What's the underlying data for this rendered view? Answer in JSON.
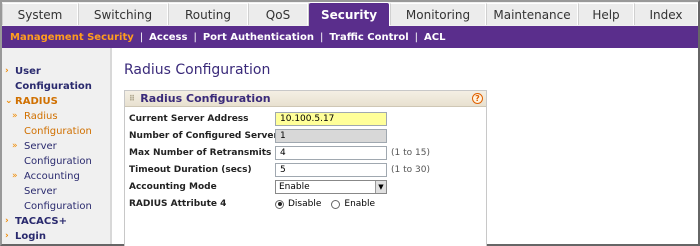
{
  "topnav": {
    "tabs": [
      {
        "label": "System",
        "active": false
      },
      {
        "label": "Switching",
        "active": false
      },
      {
        "label": "Routing",
        "active": false
      },
      {
        "label": "QoS",
        "active": false
      },
      {
        "label": "Security",
        "active": true
      },
      {
        "label": "Monitoring",
        "active": false
      },
      {
        "label": "Maintenance",
        "active": false
      },
      {
        "label": "Help",
        "active": false
      },
      {
        "label": "Index",
        "active": false
      }
    ]
  },
  "subnav": {
    "items": [
      {
        "label": "Management Security",
        "active": true
      },
      {
        "label": "Access",
        "active": false
      },
      {
        "label": "Port Authentication",
        "active": false
      },
      {
        "label": "Traffic Control",
        "active": false
      },
      {
        "label": "ACL",
        "active": false
      }
    ]
  },
  "leftnav": {
    "items": [
      {
        "label_1": "User",
        "label_2": "Configuration"
      },
      {
        "label_1": "RADIUS"
      },
      {
        "label_1": "Radius",
        "label_2": "Configuration"
      },
      {
        "label_1": "Server",
        "label_2": "Configuration"
      },
      {
        "label_1": "Accounting",
        "label_2": "Server",
        "label_3": "Configuration"
      },
      {
        "label_1": "TACACS+"
      },
      {
        "label_1": "Login"
      }
    ]
  },
  "main": {
    "page_title": "Radius Configuration",
    "panel": {
      "title": "Radius Configuration",
      "help": "?",
      "fields": {
        "server_address": {
          "label": "Current Server Address",
          "value": "10.100.5.17"
        },
        "configured_servers": {
          "label": "Number of Configured Servers",
          "value": "1"
        },
        "max_retransmits": {
          "label": "Max Number of Retransmits",
          "value": "4",
          "range": "(1 to 15)"
        },
        "timeout": {
          "label": "Timeout Duration (secs)",
          "value": "5",
          "range": "(1 to 30)"
        },
        "accounting_mode": {
          "label": "Accounting Mode",
          "value": "Enable"
        },
        "attribute4": {
          "label": "RADIUS Attribute 4",
          "option_disable": "Disable",
          "option_enable": "Enable",
          "selected": "Disable"
        }
      }
    }
  },
  "colors": {
    "accent": "#5a2e8c",
    "active_link": "#ff9d1e",
    "highlight_field": "#ffff99"
  }
}
